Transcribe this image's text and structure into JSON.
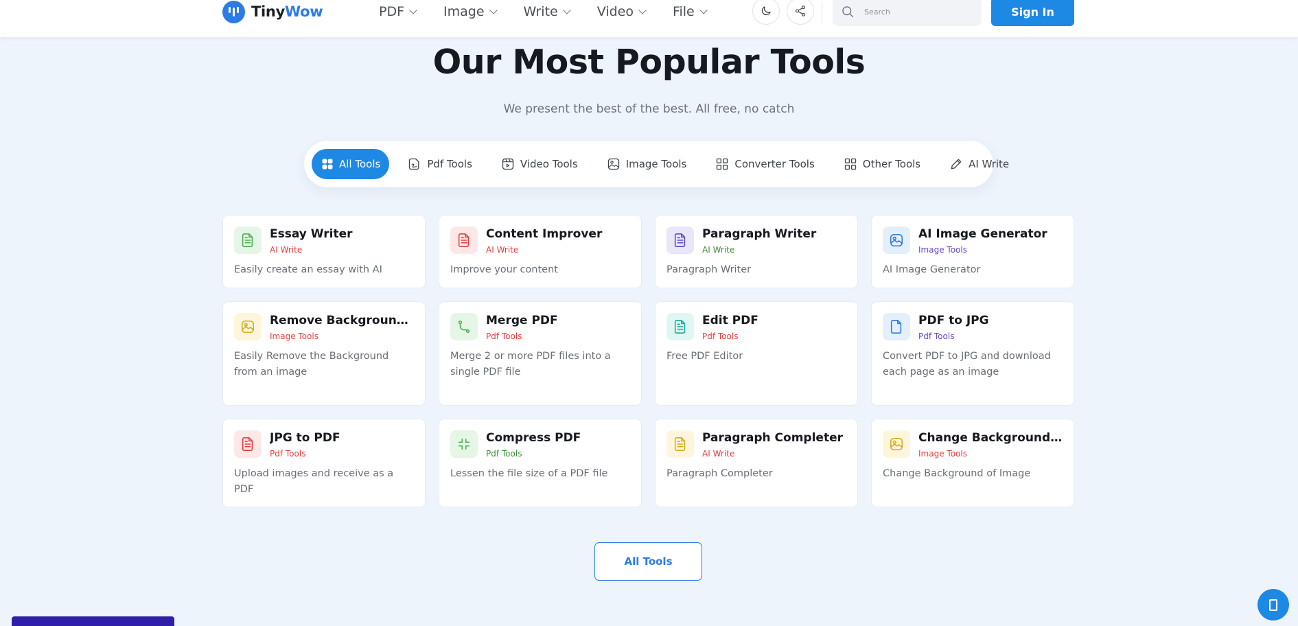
{
  "header": {
    "logo_part1": "Tiny",
    "logo_part2": "Wow",
    "nav": [
      {
        "label": "PDF"
      },
      {
        "label": "Image"
      },
      {
        "label": "Write"
      },
      {
        "label": "Video"
      },
      {
        "label": "File"
      }
    ],
    "search_placeholder": "Search",
    "signin_label": "Sign In",
    "icons": {
      "theme": "moon-icon",
      "share": "share-icon",
      "search": "search-icon"
    }
  },
  "hero": {
    "title": "Our Most Popular Tools",
    "subtitle": "We present the best of the best. All free, no catch"
  },
  "tabs": [
    {
      "label": "All Tools",
      "icon": "grid-icon",
      "active": true
    },
    {
      "label": "Pdf Tools",
      "icon": "pdf-doc-icon",
      "active": false
    },
    {
      "label": "Video Tools",
      "icon": "video-icon",
      "active": false
    },
    {
      "label": "Image Tools",
      "icon": "image-icon",
      "active": false
    },
    {
      "label": "Converter Tools",
      "icon": "converter-grid-icon",
      "active": false
    },
    {
      "label": "Other Tools",
      "icon": "other-grid-icon",
      "active": false
    },
    {
      "label": "AI Write",
      "icon": "pencil-icon",
      "active": false
    }
  ],
  "colors": {
    "accent": "#1e88e5",
    "category_ai_write": "#e53e3e",
    "category_image_tools": "#6b46c1",
    "category_pdf_tools": "#e53e3e"
  },
  "cards": [
    {
      "title": "Essay Writer",
      "category": "AI Write",
      "cat_color": "#e53e3e",
      "description": "Easily create an essay with AI",
      "icon": "document-icon",
      "icon_color": "#4caf50",
      "icon_bg": "#e6f6e6"
    },
    {
      "title": "Content Improver",
      "category": "AI Write",
      "cat_color": "#e53e3e",
      "description": "Improve your content",
      "icon": "document-icon",
      "icon_color": "#e53e3e",
      "icon_bg": "#fde8e8"
    },
    {
      "title": "Paragraph Writer",
      "category": "AI Write",
      "cat_color": "#3f8f3f",
      "description": "Paragraph Writer",
      "icon": "document-icon",
      "icon_color": "#5b4bc4",
      "icon_bg": "#e9e6f8"
    },
    {
      "title": "AI Image Generator",
      "category": "Image Tools",
      "cat_color": "#6b46c1",
      "description": "AI Image Generator",
      "icon": "image-icon",
      "icon_color": "#2d7be5",
      "icon_bg": "#e4effc"
    },
    {
      "title": "Remove Background...",
      "category": "Image Tools",
      "cat_color": "#e53e3e",
      "description": "Easily Remove the Background from an image",
      "icon": "image-icon",
      "icon_color": "#d6a91c",
      "icon_bg": "#fdf6dc"
    },
    {
      "title": "Merge PDF",
      "category": "Pdf Tools",
      "cat_color": "#e53e3e",
      "description": "Merge 2 or more PDF files into a single PDF file",
      "icon": "merge-icon",
      "icon_color": "#4caf50",
      "icon_bg": "#e6f6e6"
    },
    {
      "title": "Edit PDF",
      "category": "Pdf Tools",
      "cat_color": "#e53e3e",
      "description": "Free PDF Editor",
      "icon": "document-icon",
      "icon_color": "#1aa89c",
      "icon_bg": "#e0f6f3"
    },
    {
      "title": "PDF to JPG",
      "category": "Pdf Tools",
      "cat_color": "#6b46c1",
      "description": "Convert PDF to JPG and download each page as an image",
      "icon": "file-icon",
      "icon_color": "#2d7be5",
      "icon_bg": "#e4effc"
    },
    {
      "title": "JPG to PDF",
      "category": "Pdf Tools",
      "cat_color": "#e53e3e",
      "description": "Upload images and receive as a PDF",
      "icon": "document-icon",
      "icon_color": "#e53e3e",
      "icon_bg": "#fde8e8"
    },
    {
      "title": "Compress PDF",
      "category": "Pdf Tools",
      "cat_color": "#3f8f3f",
      "description": "Lessen the file size of a PDF file",
      "icon": "compress-icon",
      "icon_color": "#4caf50",
      "icon_bg": "#e6f6e6"
    },
    {
      "title": "Paragraph Completer",
      "category": "AI Write",
      "cat_color": "#e53e3e",
      "description": "Paragraph Completer",
      "icon": "document-icon",
      "icon_color": "#d6a91c",
      "icon_bg": "#fdf6dc"
    },
    {
      "title": "Change Background...",
      "category": "Image Tools",
      "cat_color": "#e53e3e",
      "description": "Change Background of Image",
      "icon": "image-icon",
      "icon_color": "#d6a91c",
      "icon_bg": "#fdf6dc"
    }
  ],
  "footer_button_label": "All Tools"
}
